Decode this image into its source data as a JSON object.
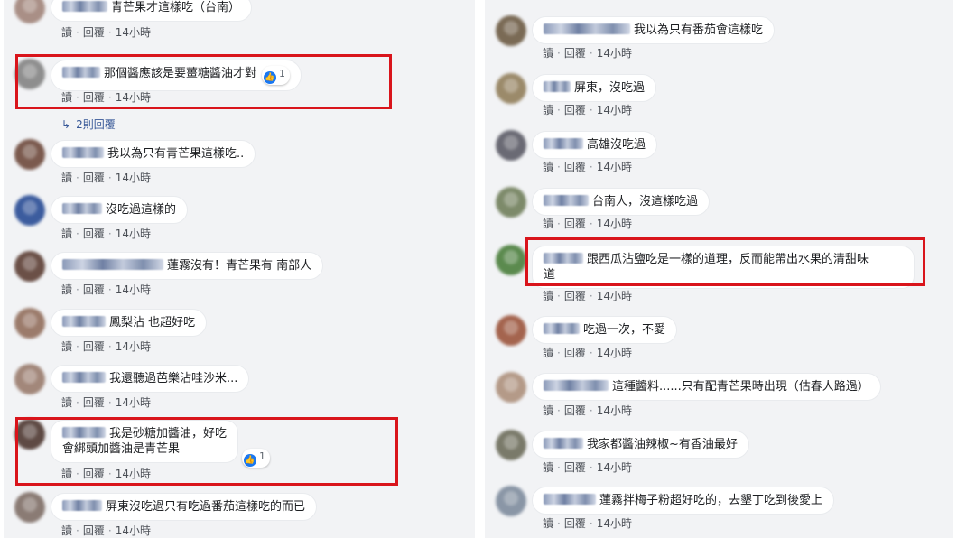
{
  "common": {
    "reply_label": "讀",
    "reply2_label": "回覆",
    "time": "14小時",
    "sep": "·",
    "like_glyph": "👍"
  },
  "colors": {
    "highlight": "#d9141b",
    "link": "#385898",
    "like": "#1877f2"
  },
  "left": {
    "replies_link": "2則回覆",
    "comments": [
      {
        "text": "青芒果才這樣吃（台南）"
      },
      {
        "text": "那個醬應該是要薑糖醬油才對",
        "likes": "1"
      },
      {
        "text": "我以為只有青芒果這樣吃.."
      },
      {
        "text": "沒吃過這樣的"
      },
      {
        "text": "蓮霧沒有！青芒果有 南部人"
      },
      {
        "text": "鳳梨沾 也超好吃"
      },
      {
        "text": "我還聽過芭樂沾哇沙米..."
      },
      {
        "text": "我是砂糖加醬油，好吃",
        "text2": "會綁頭加醬油是青芒果",
        "likes": "1"
      },
      {
        "text": "屏東沒吃過只有吃過番茄這樣吃的而已"
      }
    ]
  },
  "right": {
    "comments": [
      {
        "text": "我以為只有番茄會這樣吃"
      },
      {
        "text": "屏東，沒吃過"
      },
      {
        "text": "高雄沒吃過"
      },
      {
        "text": "台南人，沒這樣吃過"
      },
      {
        "text": "跟西瓜沾鹽吃是一樣的道理，反而能帶出水果的清甜味",
        "text2": "道"
      },
      {
        "text": "吃過一次，不愛"
      },
      {
        "text": "這種醬料......只有配青芒果時出現（估春人路過）"
      },
      {
        "text": "我家都醬油辣椒~有香油最好"
      },
      {
        "text": "蓮霧拌梅子粉超好吃的，去墾丁吃到後愛上"
      }
    ]
  }
}
